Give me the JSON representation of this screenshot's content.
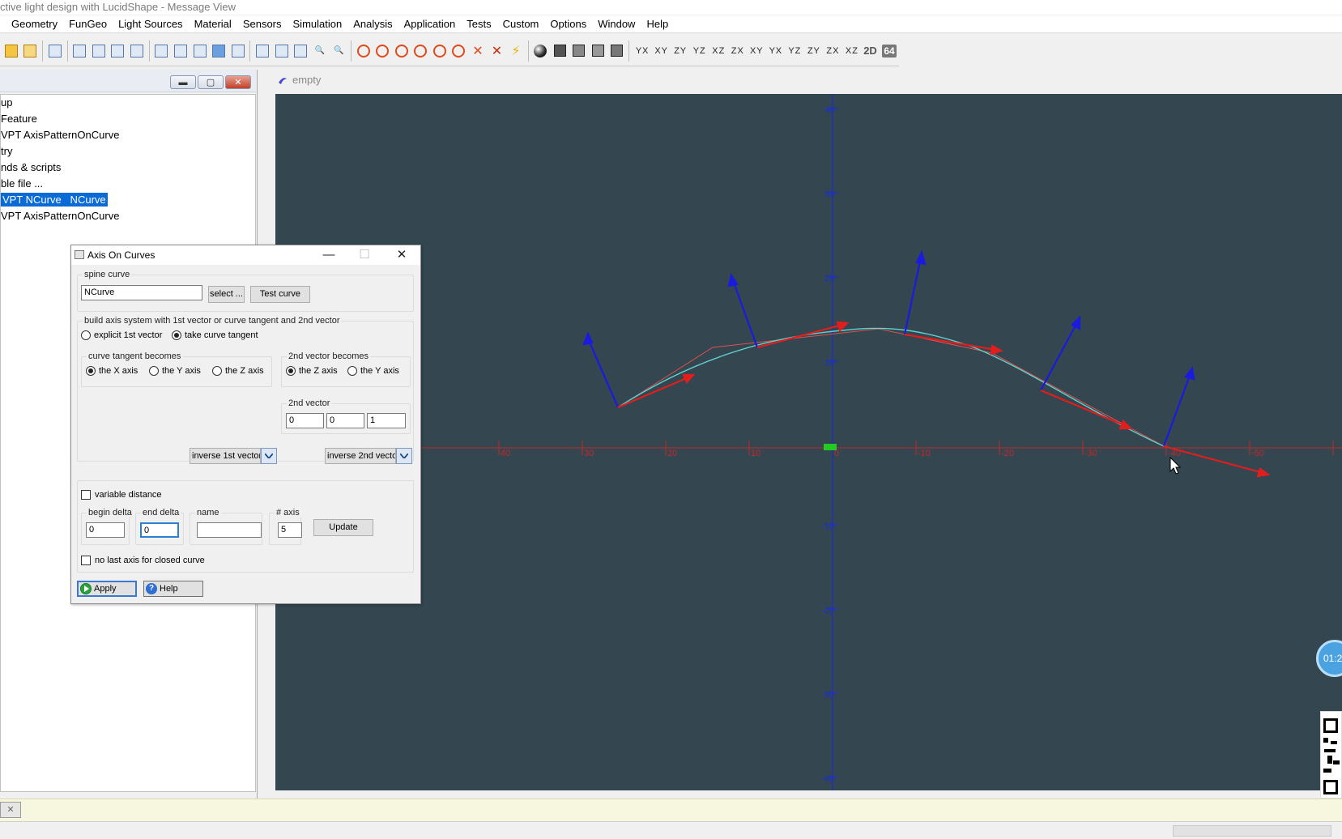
{
  "window_title": "ctive light design with LucidShape - Message View",
  "menu": [
    "Geometry",
    "FunGeo",
    "Light Sources",
    "Material",
    "Sensors",
    "Simulation",
    "Analysis",
    "Application",
    "Tests",
    "Custom",
    "Options",
    "Window",
    "Help"
  ],
  "toolbar": {
    "label_2d": "2D",
    "label_64": "64",
    "axis_buttons": [
      "Y X",
      "X Y",
      "Z Y",
      "Y Z",
      "X Z",
      "Z X",
      "X Y",
      "Y X",
      "Y Z",
      "Z Y",
      "Z X",
      "X Z"
    ]
  },
  "tree": {
    "items": [
      "up",
      "Feature",
      "VPT AxisPatternOnCurve",
      "try",
      "nds & scripts",
      "ble file ...",
      "VPT NCurve   NCurve",
      "VPT AxisPatternOnCurve"
    ],
    "selected_index": 6
  },
  "view": {
    "tab_label": "empty"
  },
  "canvas": {
    "x_ticks": [
      "40",
      "30",
      "20",
      "10",
      "0",
      "-10",
      "-20",
      "-30",
      "-40",
      "-50"
    ],
    "y_ticks": [
      "40",
      "30",
      "20",
      "10",
      "-10",
      "-20",
      "-30",
      "-40"
    ],
    "colors": {
      "background": "#34464f",
      "axis_x": "#c0282a",
      "axis_y": "#1a2fd0",
      "curve": "#5fd3d0",
      "vector_red": "#e01e1e",
      "vector_blue": "#1a1ae0"
    }
  },
  "dialog": {
    "title": "Axis On Curves",
    "spine_curve": {
      "label": "spine curve",
      "value": "NCurve",
      "select_label": "select ...",
      "test_label": "Test curve"
    },
    "build": {
      "label": "build axis system with 1st vector or curve tangent and 2nd vector",
      "explicit_label": "explicit 1st vector",
      "tangent_label": "take curve tangent",
      "tangent_selected": true
    },
    "tangent_becomes": {
      "label": "curve tangent becomes",
      "opt_x": "the X axis",
      "opt_y": "the Y axis",
      "opt_z": "the Z axis",
      "selected": "x"
    },
    "second_becomes": {
      "label": "2nd vector becomes",
      "opt_z": "the Z axis",
      "opt_y": "the Y axis",
      "selected": "z"
    },
    "second_vector": {
      "label": "2nd vector",
      "x": "0",
      "y": "0",
      "z": "1"
    },
    "inverse_1st": "inverse 1st vector",
    "inverse_2nd": "inverse 2nd vecto",
    "variable_distance": "variable distance",
    "begin_delta": {
      "label": "begin delta",
      "value": "0"
    },
    "end_delta": {
      "label": "end delta",
      "value": "0"
    },
    "name": {
      "label": "name",
      "value": ""
    },
    "num_axis": {
      "label": "# axis",
      "value": "5"
    },
    "update_label": "Update",
    "no_last_axis": "no last axis for closed curve",
    "apply_label": "Apply",
    "help_label": "Help"
  },
  "overlay": {
    "timer": "01:2"
  }
}
